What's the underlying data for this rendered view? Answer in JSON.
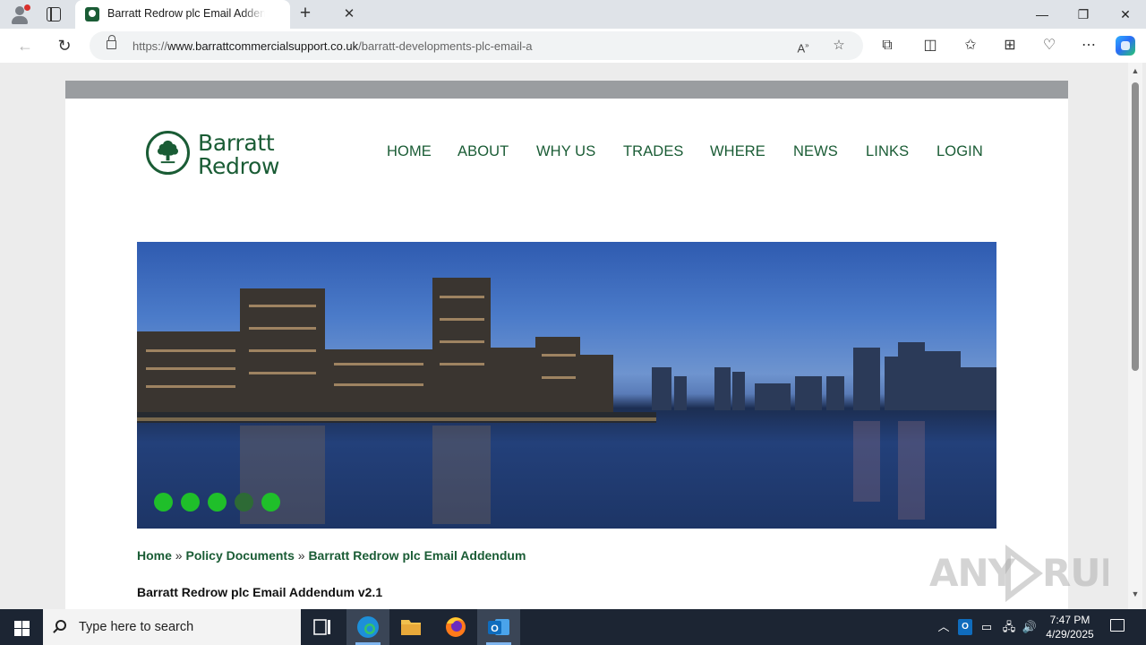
{
  "browser": {
    "tab_title": "Barratt Redrow plc Email Addendum",
    "tab_close": "✕",
    "new_tab": "+",
    "url_prefix": "https://",
    "url_domain": "www.barrattcommercialsupport.co.uk",
    "url_path": "/barratt-developments-plc-email-a",
    "icons": [
      "profile-icon",
      "tab-actions-icon",
      "back-icon",
      "refresh-icon",
      "lock-icon",
      "read-aloud-icon",
      "favorite-icon",
      "extensions-icon",
      "split-screen-icon",
      "favorites-icon",
      "collections-icon",
      "browser-essentials-icon",
      "more-icon",
      "copilot-icon"
    ],
    "window_controls": {
      "minimize": "—",
      "restore": "❐",
      "close": "✕"
    }
  },
  "site": {
    "logo": {
      "line1": "Barratt",
      "line2": "Redrow"
    },
    "nav": [
      "HOME",
      "ABOUT",
      "WHY US",
      "TRADES",
      "WHERE",
      "NEWS",
      "LINKS",
      "LOGIN"
    ],
    "slider": {
      "total": 5,
      "active_index": 3,
      "color": "#1fbf2a",
      "active_color": "#2d6a35"
    },
    "breadcrumb": [
      "Home",
      "Policy Documents",
      "Barratt Redrow plc Email Addendum"
    ],
    "breadcrumb_separator": "»",
    "document_title": "Barratt Redrow plc Email Addendum v2.1",
    "brand_color": "#1a5c35"
  },
  "watermark": "ANY RUN",
  "taskbar": {
    "search_placeholder": "Type here to search",
    "apps": [
      "task-view-icon",
      "edge-icon",
      "file-explorer-icon",
      "firefox-icon",
      "outlook-icon"
    ],
    "time": "7:47 PM",
    "date": "4/29/2025"
  }
}
